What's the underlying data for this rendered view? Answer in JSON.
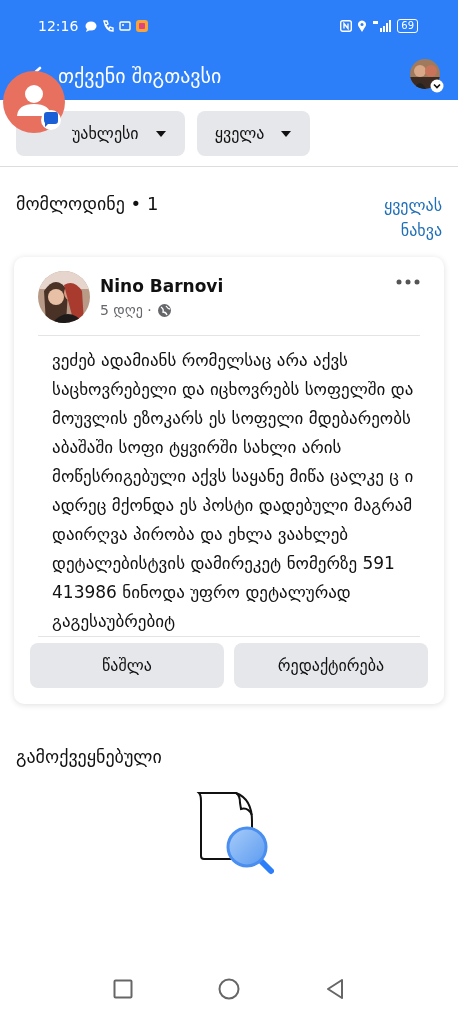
{
  "status_bar": {
    "time": "12:16",
    "battery": "69"
  },
  "header": {
    "title": "თქვენი შიგთავსი"
  },
  "filters": [
    {
      "label": "უახლესი",
      "covered": true
    },
    {
      "label": "ყველა",
      "covered": false
    }
  ],
  "pending": {
    "title": "მომლოდინე • 1",
    "see_all": "ყველას ნახვა"
  },
  "post": {
    "author": "Nino Barnovi",
    "time": "5 დღე ·",
    "text": "ვეძებ ადამიანს რომელსაც არა აქვს საცხოვრებელი და იცხოვრებს სოფელში და მოუვლის ეზოკარს ეს სოფელი მდებარეობს აბაშაში სოფი ტყვირში სახლი არის მოწესრიგებული აქვს საყანე მიწა ცალკე ც ი ადრეც მქონდა ეს პოსტი დადებული მაგრამ დაირღვა პირობა და ეხლა ვაახლებ დეტალებისტვის დამირეკეტ ნომერზე 591 413986 ნინოდა უფრო დეტალურად გაგესაუბრებიტ",
    "buttons": [
      {
        "label": "წაშლა"
      },
      {
        "label": "რედაქტირება"
      }
    ]
  },
  "published": {
    "title": "გამოქვეყნებული"
  }
}
